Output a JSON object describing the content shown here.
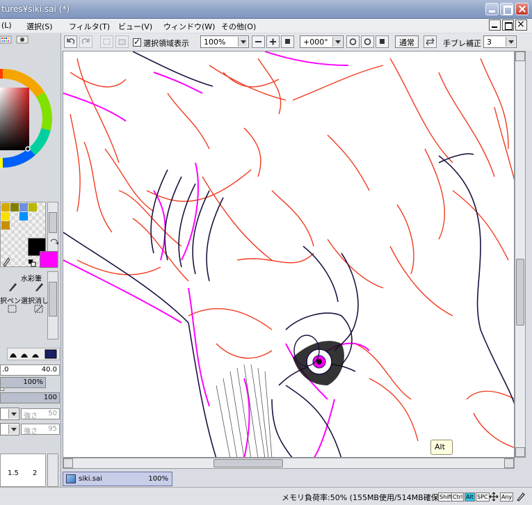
{
  "window": {
    "title": "tures¥siki.sai (*)"
  },
  "menu": [
    "(L)",
    "選択(S)",
    "フィルタ(T)",
    "ビュー(V)",
    "ウィンドウ(W)",
    "その他(O)"
  ],
  "toolbar": {
    "show_selection_label": "選択領域表示",
    "zoom_value": "100%",
    "rotation_value": "+000°",
    "blend_mode": "通常",
    "stabilizer_label": "手ブレ補正",
    "stabilizer_value": "3"
  },
  "tools": {
    "watercolor": "水彩筆",
    "select_pen": "択ペン",
    "deselect": "選択消し"
  },
  "brush": {
    "size_value": "40.0",
    "size_left": ".0",
    "density_value": "100%",
    "blending_value": "100",
    "strength_label": "強さ",
    "strength_value_1": "50",
    "strength_value_2": "95",
    "ticks": [
      "1.5",
      "2"
    ]
  },
  "colors": {
    "foreground": "#000000",
    "background": "#ff00ff"
  },
  "document": {
    "name": "siki.sai",
    "zoom": "100%"
  },
  "tooltip": "Alt",
  "status": {
    "memory": "メモリ負荷率:50% (155MB使用/514MB確保)",
    "keys": [
      "Shift",
      "Ctrl",
      "Alt",
      "SPC",
      "Any"
    ]
  }
}
